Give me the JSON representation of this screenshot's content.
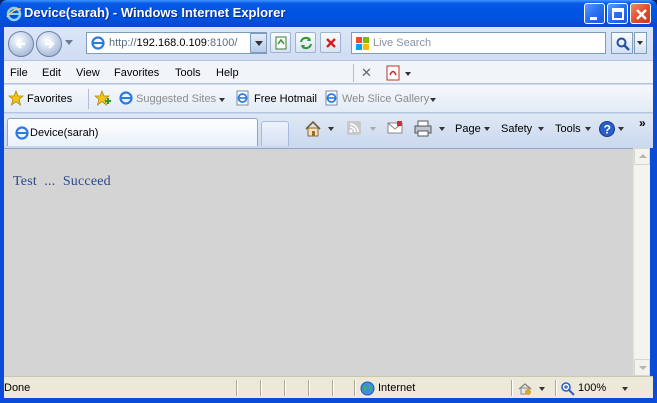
{
  "window": {
    "title": "Device(sarah) - Windows Internet Explorer"
  },
  "address": {
    "url_prefix": "http://",
    "url_host": "192.168.0.109",
    "url_port": ":8100/"
  },
  "search": {
    "placeholder": "Live Search"
  },
  "menu": {
    "items": [
      "File",
      "Edit",
      "View",
      "Favorites",
      "Tools",
      "Help"
    ]
  },
  "favorites_bar": {
    "favorites_label": "Favorites",
    "suggested_sites": "Suggested Sites",
    "free_hotmail": "Free Hotmail",
    "web_slice_gallery": "Web Slice Gallery"
  },
  "tabs": {
    "active_tab": "Device(sarah)"
  },
  "command_bar": {
    "page": "Page",
    "safety": "Safety",
    "tools": "Tools"
  },
  "content": {
    "text": "Test  ...  Succeed"
  },
  "status": {
    "text": "Done",
    "zone": "Internet",
    "zoom": "100%"
  },
  "colors": {
    "titlebar": "#0054e3",
    "content_bg": "#d4d4d4",
    "content_text": "#2b4a86"
  }
}
